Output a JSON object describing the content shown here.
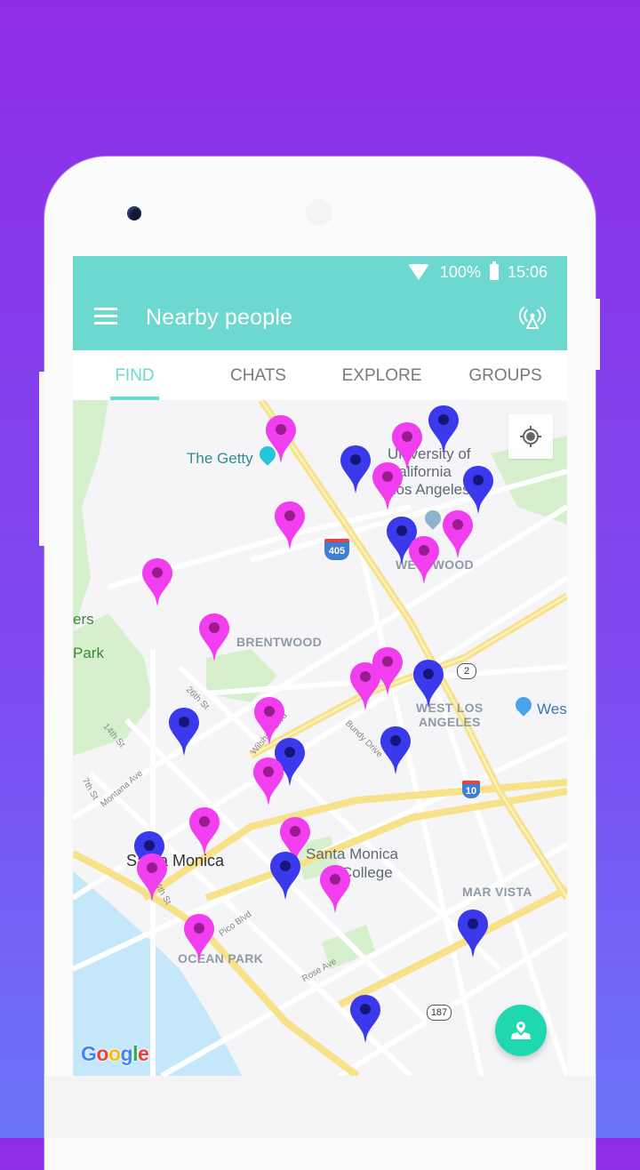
{
  "status_bar": {
    "battery": "100%",
    "time": "15:06",
    "wifi_icon": "wifi-icon",
    "battery_icon": "battery-icon"
  },
  "app_bar": {
    "title": "Nearby people",
    "menu_icon": "menu-icon",
    "action_icon": "broadcast-icon"
  },
  "tabs": [
    {
      "label": "FIND",
      "active": true
    },
    {
      "label": "CHATS",
      "active": false
    },
    {
      "label": "EXPLORE",
      "active": false
    },
    {
      "label": "GROUPS",
      "active": false
    }
  ],
  "colors": {
    "primary": "#6dd8cf",
    "fab": "#1fd8b0",
    "pin_female": "#f13ff0",
    "pin_female_dot": "#9a1a8f",
    "pin_male": "#3a39ec",
    "pin_male_dot": "#15157a"
  },
  "map": {
    "labels": {
      "getty": "The Getty",
      "ucla": [
        "University of",
        "California",
        "Los Angeles"
      ],
      "westwood": "WESTWOOD",
      "brentwood": "BRENTWOOD",
      "west_la": [
        "WEST LOS",
        "ANGELES"
      ],
      "wes": "Wes",
      "santa_monica": "Santa Monica",
      "smc": [
        "Santa Monica",
        "College"
      ],
      "ocean_park": "OCEAN PARK",
      "mar_vista": "MAR VISTA",
      "park_partial": [
        "ers",
        "Park"
      ],
      "streets": [
        "26th St",
        "14th St",
        "7th St",
        "Montana Ave",
        "Wilshire Blvd",
        "Bundy Drive",
        "Pico Blvd",
        "Rose Ave",
        "4th St"
      ],
      "shields": [
        "405",
        "2",
        "10",
        "187"
      ]
    },
    "attribution": "Google",
    "my_location_icon": "my-location-icon",
    "fab_icon": "map-pin-icon",
    "people": [
      {
        "gender": "female",
        "lat": 0.045,
        "lng": 0.42
      },
      {
        "gender": "male",
        "lat": 0.03,
        "lng": 0.75
      },
      {
        "gender": "female",
        "lat": 0.055,
        "lng": 0.677
      },
      {
        "gender": "male",
        "lat": 0.09,
        "lng": 0.572
      },
      {
        "gender": "female",
        "lat": 0.115,
        "lng": 0.636
      },
      {
        "gender": "male",
        "lat": 0.12,
        "lng": 0.82
      },
      {
        "gender": "female",
        "lat": 0.173,
        "lng": 0.438
      },
      {
        "gender": "female",
        "lat": 0.186,
        "lng": 0.779
      },
      {
        "gender": "male",
        "lat": 0.195,
        "lng": 0.665
      },
      {
        "gender": "female",
        "lat": 0.224,
        "lng": 0.71
      },
      {
        "gender": "female",
        "lat": 0.257,
        "lng": 0.171
      },
      {
        "gender": "female",
        "lat": 0.338,
        "lng": 0.286
      },
      {
        "gender": "female",
        "lat": 0.388,
        "lng": 0.637
      },
      {
        "gender": "female",
        "lat": 0.41,
        "lng": 0.592
      },
      {
        "gender": "male",
        "lat": 0.406,
        "lng": 0.719
      },
      {
        "gender": "female",
        "lat": 0.462,
        "lng": 0.397
      },
      {
        "gender": "male",
        "lat": 0.477,
        "lng": 0.225
      },
      {
        "gender": "male",
        "lat": 0.522,
        "lng": 0.439
      },
      {
        "gender": "male",
        "lat": 0.505,
        "lng": 0.653
      },
      {
        "gender": "female",
        "lat": 0.551,
        "lng": 0.395
      },
      {
        "gender": "female",
        "lat": 0.625,
        "lng": 0.266
      },
      {
        "gender": "female",
        "lat": 0.64,
        "lng": 0.45
      },
      {
        "gender": "male",
        "lat": 0.66,
        "lng": 0.155
      },
      {
        "gender": "male",
        "lat": 0.691,
        "lng": 0.43
      },
      {
        "gender": "female",
        "lat": 0.693,
        "lng": 0.16
      },
      {
        "gender": "female",
        "lat": 0.711,
        "lng": 0.531
      },
      {
        "gender": "female",
        "lat": 0.783,
        "lng": 0.255
      },
      {
        "gender": "male",
        "lat": 0.776,
        "lng": 0.809
      },
      {
        "gender": "male",
        "lat": 0.903,
        "lng": 0.592
      }
    ]
  }
}
